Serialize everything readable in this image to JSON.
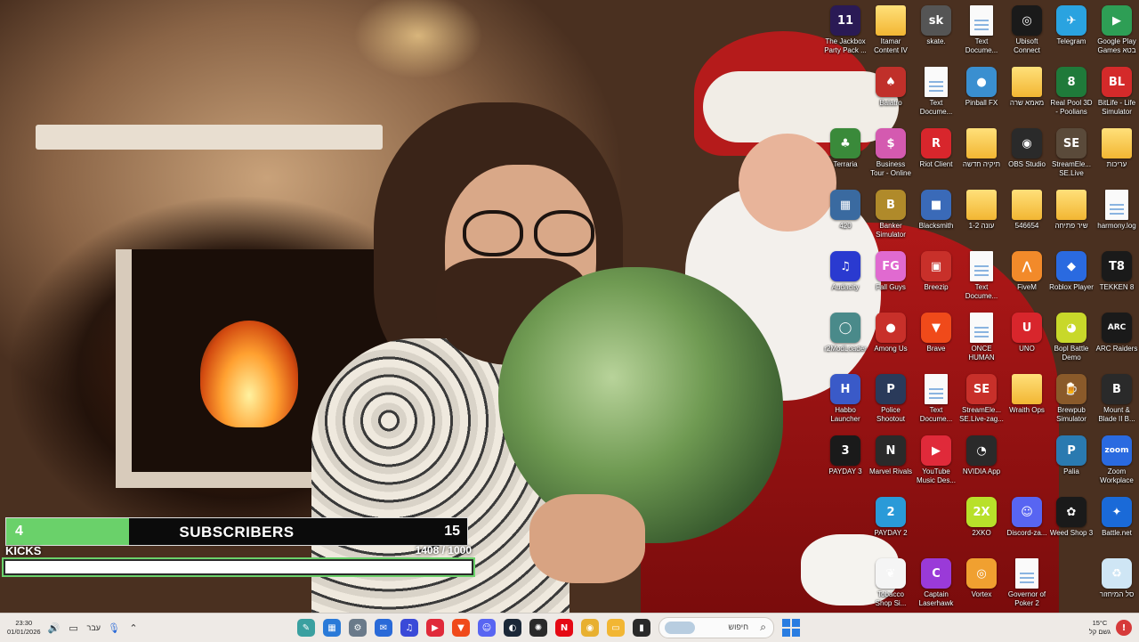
{
  "overlay": {
    "subscribers": {
      "current": "4",
      "label": "SUBSCRIBERS",
      "goal": "15",
      "progress": 0.267
    },
    "kicks": {
      "label": "KICKS",
      "count": "1408",
      "goal": "/ 1000",
      "progress": 1.0
    }
  },
  "desktop_icons": [
    {
      "label": "The Jackbox Party Pack ...",
      "icon": "jackbox-icon",
      "kind": "app",
      "color": "#2a1a55",
      "glyph": "11"
    },
    {
      "label": "Itamar Content IV",
      "icon": "folder-icon",
      "kind": "folder",
      "color": "#f2b633",
      "glyph": ""
    },
    {
      "label": "skate.",
      "icon": "skate-icon",
      "kind": "app",
      "color": "#555555",
      "glyph": "sk"
    },
    {
      "label": "Text Docume...",
      "icon": "text-document-icon",
      "kind": "doc",
      "color": "#ffffff",
      "glyph": ""
    },
    {
      "label": "Ubisoft Connect",
      "icon": "ubisoft-icon",
      "kind": "app",
      "color": "#1a1a1a",
      "glyph": "◎"
    },
    {
      "label": "Telegram",
      "icon": "telegram-icon",
      "kind": "app",
      "color": "#2aa3e0",
      "glyph": "✈"
    },
    {
      "label": "Google Play Games בטא",
      "icon": "google-play-games-icon",
      "kind": "app",
      "color": "#2e9e55",
      "glyph": "▶"
    },
    {
      "label": "Balatro",
      "icon": "balatro-icon",
      "kind": "app",
      "color": "#c0302a",
      "glyph": "♠"
    },
    {
      "label": "Text Docume...",
      "icon": "text-document-icon",
      "kind": "doc",
      "color": "#ffffff",
      "glyph": ""
    },
    {
      "label": "Pinball FX",
      "icon": "pinball-fx-icon",
      "kind": "app",
      "color": "#3a8fd0",
      "glyph": "●"
    },
    {
      "label": "מאמא שרה",
      "icon": "folder-icon",
      "kind": "folder",
      "color": "#f2b633",
      "glyph": ""
    },
    {
      "label": "Real Pool 3D - Poolians",
      "icon": "real-pool-icon",
      "kind": "app",
      "color": "#1f7a3a",
      "glyph": "8"
    },
    {
      "label": "BitLife - Life Simulator",
      "icon": "bitlife-icon",
      "kind": "app",
      "color": "#d42a2a",
      "glyph": "BL"
    },
    {
      "label": "Terraria",
      "icon": "terraria-icon",
      "kind": "app",
      "color": "#3a8a3a",
      "glyph": "♣"
    },
    {
      "label": "Business Tour - Online M...",
      "icon": "business-tour-icon",
      "kind": "app",
      "color": "#d45ab0",
      "glyph": "$"
    },
    {
      "label": "Riot Client",
      "icon": "riot-client-icon",
      "kind": "app",
      "color": "#d8262c",
      "glyph": "R"
    },
    {
      "label": "תיקיה חדשה",
      "icon": "folder-icon",
      "kind": "folder",
      "color": "#f2b633",
      "glyph": ""
    },
    {
      "label": "OBS Studio",
      "icon": "obs-studio-icon",
      "kind": "app",
      "color": "#2a2a2a",
      "glyph": "◉"
    },
    {
      "label": "StreamEle... SE.Live",
      "icon": "streamelements-icon",
      "kind": "app",
      "color": "#5a4a3a",
      "glyph": "SE"
    },
    {
      "label": "עריכות",
      "icon": "folder-icon",
      "kind": "folder",
      "color": "#f2b633",
      "glyph": ""
    },
    {
      "label": "420",
      "icon": "image-file-icon",
      "kind": "app",
      "color": "#3a6aa0",
      "glyph": "▦"
    },
    {
      "label": "Banker Simulator",
      "icon": "banker-simulator-icon",
      "kind": "app",
      "color": "#b08a2a",
      "glyph": "B"
    },
    {
      "label": "Blacksmith",
      "icon": "blacksmith-icon",
      "kind": "app",
      "color": "#3a6ab8",
      "glyph": "■"
    },
    {
      "label": "1-2 עונה",
      "icon": "folder-icon",
      "kind": "folder",
      "color": "#f2b633",
      "glyph": ""
    },
    {
      "label": "546654",
      "icon": "folder-icon",
      "kind": "folder",
      "color": "#f2b633",
      "glyph": ""
    },
    {
      "label": "שיר פתיחה",
      "icon": "folder-icon",
      "kind": "folder",
      "color": "#f2b633",
      "glyph": ""
    },
    {
      "label": "harmony.log",
      "icon": "log-file-icon",
      "kind": "doc",
      "color": "#ffffff",
      "glyph": ""
    },
    {
      "label": "Audacity",
      "icon": "audacity-icon",
      "kind": "app",
      "color": "#2a3ad0",
      "glyph": "♫"
    },
    {
      "label": "Fall Guys",
      "icon": "fall-guys-icon",
      "kind": "app",
      "color": "#e06ad0",
      "glyph": "FG"
    },
    {
      "label": "Breezip",
      "icon": "breezip-icon",
      "kind": "app",
      "color": "#c8302a",
      "glyph": "▣"
    },
    {
      "label": "Text Docume...",
      "icon": "text-document-icon",
      "kind": "doc",
      "color": "#ffffff",
      "glyph": ""
    },
    {
      "label": "FiveM",
      "icon": "fivem-icon",
      "kind": "app",
      "color": "#f28a2a",
      "glyph": "⋀"
    },
    {
      "label": "Roblox Player",
      "icon": "roblox-icon",
      "kind": "app",
      "color": "#2a6ae0",
      "glyph": "◆"
    },
    {
      "label": "TEKKEN 8",
      "icon": "tekken-icon",
      "kind": "app",
      "color": "#1a1a1a",
      "glyph": "T8"
    },
    {
      "label": "r2ModLoader",
      "icon": "r2modloader-icon",
      "kind": "app",
      "color": "#4a8a8a",
      "glyph": "◯"
    },
    {
      "label": "Among Us",
      "icon": "among-us-icon",
      "kind": "app",
      "color": "#c8302a",
      "glyph": "●"
    },
    {
      "label": "Brave",
      "icon": "brave-icon",
      "kind": "app",
      "color": "#f04a1a",
      "glyph": "▼"
    },
    {
      "label": "ONCE HUMAN",
      "icon": "once-human-icon",
      "kind": "doc",
      "color": "#ffffff",
      "glyph": ""
    },
    {
      "label": "UNO",
      "icon": "uno-icon",
      "kind": "app",
      "color": "#d8262c",
      "glyph": "U"
    },
    {
      "label": "Bopl Battle Demo",
      "icon": "bopl-battle-icon",
      "kind": "app",
      "color": "#c8d82a",
      "glyph": "◕"
    },
    {
      "label": "ARC Raiders",
      "icon": "arc-raiders-icon",
      "kind": "app",
      "color": "#1a1a1a",
      "glyph": "ARC"
    },
    {
      "label": "Habbo Launcher",
      "icon": "habbo-icon",
      "kind": "app",
      "color": "#3a5ac8",
      "glyph": "H"
    },
    {
      "label": "Police Shootout",
      "icon": "police-shootout-icon",
      "kind": "app",
      "color": "#2a3a5a",
      "glyph": "P"
    },
    {
      "label": "Text Docume...",
      "icon": "text-document-icon",
      "kind": "doc",
      "color": "#ffffff",
      "glyph": ""
    },
    {
      "label": "StreamEle... SE.Live-zag...",
      "icon": "streamelements-icon",
      "kind": "app",
      "color": "#c8302a",
      "glyph": "SE"
    },
    {
      "label": "Wraith Ops",
      "icon": "folder-icon",
      "kind": "folder",
      "color": "#f2b633",
      "glyph": ""
    },
    {
      "label": "Brewpub Simulator",
      "icon": "brewpub-icon",
      "kind": "app",
      "color": "#8a5a2a",
      "glyph": "🍺"
    },
    {
      "label": "Mount & Blade II B...",
      "icon": "mount-blade-icon",
      "kind": "app",
      "color": "#2a2a2a",
      "glyph": "B"
    },
    {
      "label": "PAYDAY 3",
      "icon": "payday-3-icon",
      "kind": "app",
      "color": "#1a1a1a",
      "glyph": "3"
    },
    {
      "label": "Marvel Rivals",
      "icon": "marvel-rivals-icon",
      "kind": "app",
      "color": "#2a2a2a",
      "glyph": "N"
    },
    {
      "label": "YouTube Music Des...",
      "icon": "youtube-music-icon",
      "kind": "app",
      "color": "#e02a3a",
      "glyph": "▶"
    },
    {
      "label": "NVIDIA App",
      "icon": "nvidia-icon",
      "kind": "app",
      "color": "#2a2a2a",
      "glyph": "◔"
    },
    {
      "label": "Palia",
      "icon": "palia-icon",
      "kind": "app",
      "color": "#2a7ab0",
      "glyph": "P"
    },
    {
      "label": "Zoom Workplace",
      "icon": "zoom-icon",
      "kind": "app",
      "color": "#2a6ae0",
      "glyph": "zoom"
    },
    {
      "label": "PAYDAY 2",
      "icon": "payday-2-icon",
      "kind": "app",
      "color": "#2a9ad8",
      "glyph": "2"
    },
    {
      "label": "2XKO",
      "icon": "2xko-icon",
      "kind": "app",
      "color": "#b8e02a",
      "glyph": "2X"
    },
    {
      "label": "Discord-za...",
      "icon": "discord-icon",
      "kind": "app",
      "color": "#5865f2",
      "glyph": "☺"
    },
    {
      "label": "Weed Shop 3",
      "icon": "weed-shop-icon",
      "kind": "app",
      "color": "#1a1a1a",
      "glyph": "✿"
    },
    {
      "label": "Battle.net",
      "icon": "battle-net-icon",
      "kind": "app",
      "color": "#1a6ad8",
      "glyph": "✦"
    },
    {
      "label": "Tobacco Shop Si...",
      "icon": "tobacco-shop-icon",
      "kind": "app",
      "color": "#f5f5f5",
      "glyph": "❦"
    },
    {
      "label": "Captain Laserhawk",
      "icon": "captain-laserhawk-icon",
      "kind": "app",
      "color": "#9a3ad8",
      "glyph": "C"
    },
    {
      "label": "Vortex",
      "icon": "vortex-icon",
      "kind": "app",
      "color": "#f0a030",
      "glyph": "◎"
    },
    {
      "label": "Governor of Poker 2",
      "icon": "governor-poker-icon",
      "kind": "doc",
      "color": "#ffffff",
      "glyph": ""
    },
    {
      "label": "סל המיחזור",
      "icon": "recycle-bin-icon",
      "kind": "app",
      "color": "#cfe6f5",
      "glyph": "♻"
    }
  ],
  "taskbar": {
    "time": "23:30",
    "date": "01/01/2026",
    "language": "עבר",
    "search_placeholder": "חיפוש",
    "weather_temp": "15°C",
    "weather_desc": "גשם קל",
    "apps": [
      {
        "icon": "greenshot-icon",
        "color": "#3aa0a0",
        "glyph": "✎"
      },
      {
        "icon": "store-icon",
        "color": "#2a7ad8",
        "glyph": "▦"
      },
      {
        "icon": "settings-icon",
        "color": "#6a7a8a",
        "glyph": "⚙"
      },
      {
        "icon": "outlook-icon",
        "color": "#2a6ad8",
        "glyph": "✉"
      },
      {
        "icon": "audacity-icon",
        "color": "#3a4ad8",
        "glyph": "♫"
      },
      {
        "icon": "youtube-music-icon",
        "color": "#e02a3a",
        "glyph": "▶"
      },
      {
        "icon": "brave-icon",
        "color": "#f04a1a",
        "glyph": "▼"
      },
      {
        "icon": "discord-icon",
        "color": "#5865f2",
        "glyph": "☺"
      },
      {
        "icon": "steam-icon",
        "color": "#1b2838",
        "glyph": "◐"
      },
      {
        "icon": "chatgpt-icon",
        "color": "#2a2a2a",
        "glyph": "✺"
      },
      {
        "icon": "netflix-icon",
        "color": "#e50914",
        "glyph": "N"
      },
      {
        "icon": "chrome-icon",
        "color": "#e8b030",
        "glyph": "◉"
      },
      {
        "icon": "file-explorer-icon",
        "color": "#f2b633",
        "glyph": "▭"
      },
      {
        "icon": "terminal-icon",
        "color": "#2a2a2a",
        "glyph": "▮"
      }
    ]
  }
}
